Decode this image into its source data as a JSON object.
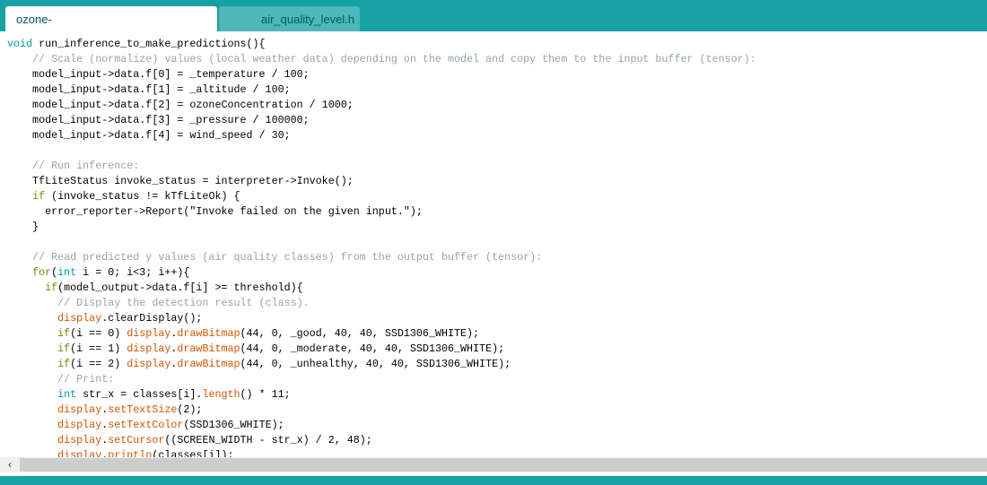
{
  "tabs": [
    {
      "label": "ozone-enabled_weather_station_run_model",
      "active": true
    },
    {
      "label": "air_quality_level.h",
      "active": false
    }
  ],
  "colors": {
    "accent": "#17a1a5",
    "keyword": "#00979c",
    "control": "#728e00",
    "function": "#d35400",
    "comment": "#95a5a6"
  },
  "scrollbar": {
    "left_arrow_icon": "chevron-left-icon",
    "left_arrow": "‹"
  },
  "code_lines": [
    [
      [
        "void",
        "kw"
      ],
      [
        " run_inference_to_make_predictions(){",
        ""
      ]
    ],
    [
      [
        "    // Scale (normalize) values (local weather data) depending on the model and copy them to the input buffer (tensor):",
        "cm"
      ]
    ],
    [
      [
        "    model_input->data.f[0] = _temperature / 100;",
        ""
      ]
    ],
    [
      [
        "    model_input->data.f[1] = _altitude / 100;",
        ""
      ]
    ],
    [
      [
        "    model_input->data.f[2] = ozoneConcentration / 1000;",
        ""
      ]
    ],
    [
      [
        "    model_input->data.f[3] = _pressure / 100000;",
        ""
      ]
    ],
    [
      [
        "    model_input->data.f[4] = wind_speed / 30;",
        ""
      ]
    ],
    [
      [
        "",
        ""
      ]
    ],
    [
      [
        "    // Run inference:",
        "cm"
      ]
    ],
    [
      [
        "    TfLiteStatus invoke_status = interpreter->Invoke();",
        ""
      ]
    ],
    [
      [
        "    ",
        ""
      ],
      [
        "if",
        "ctl"
      ],
      [
        " (invoke_status != kTfLiteOk) {",
        ""
      ]
    ],
    [
      [
        "      error_reporter->Report(\"Invoke failed on the given input.\");",
        ""
      ]
    ],
    [
      [
        "    }",
        ""
      ]
    ],
    [
      [
        "",
        ""
      ]
    ],
    [
      [
        "    // Read predicted y values (air quality classes) from the output buffer (tensor):",
        "cm"
      ]
    ],
    [
      [
        "    ",
        ""
      ],
      [
        "for",
        "ctl"
      ],
      [
        "(",
        ""
      ],
      [
        "int",
        "kw"
      ],
      [
        " i = 0; i<3; i++){",
        ""
      ]
    ],
    [
      [
        "      ",
        ""
      ],
      [
        "if",
        "ctl"
      ],
      [
        "(model_output->data.f[i] >= threshold){",
        ""
      ]
    ],
    [
      [
        "        // Display the detection result (class).",
        "cm"
      ]
    ],
    [
      [
        "        ",
        ""
      ],
      [
        "display",
        "fn"
      ],
      [
        ".clearDisplay();",
        ""
      ]
    ],
    [
      [
        "        ",
        ""
      ],
      [
        "if",
        "ctl"
      ],
      [
        "(i == 0) ",
        ""
      ],
      [
        "display",
        "fn"
      ],
      [
        ".",
        ""
      ],
      [
        "drawBitmap",
        "fn"
      ],
      [
        "(44, 0, _good, 40, 40, SSD1306_WHITE);",
        ""
      ]
    ],
    [
      [
        "        ",
        ""
      ],
      [
        "if",
        "ctl"
      ],
      [
        "(i == 1) ",
        ""
      ],
      [
        "display",
        "fn"
      ],
      [
        ".",
        ""
      ],
      [
        "drawBitmap",
        "fn"
      ],
      [
        "(44, 0, _moderate, 40, 40, SSD1306_WHITE);",
        ""
      ]
    ],
    [
      [
        "        ",
        ""
      ],
      [
        "if",
        "ctl"
      ],
      [
        "(i == 2) ",
        ""
      ],
      [
        "display",
        "fn"
      ],
      [
        ".",
        ""
      ],
      [
        "drawBitmap",
        "fn"
      ],
      [
        "(44, 0, _unhealthy, 40, 40, SSD1306_WHITE);",
        ""
      ]
    ],
    [
      [
        "        // Print:",
        "cm"
      ]
    ],
    [
      [
        "        ",
        ""
      ],
      [
        "int",
        "kw"
      ],
      [
        " str_x = classes[i].",
        ""
      ],
      [
        "length",
        "fn"
      ],
      [
        "() * 11;",
        ""
      ]
    ],
    [
      [
        "        ",
        ""
      ],
      [
        "display",
        "fn"
      ],
      [
        ".",
        ""
      ],
      [
        "setTextSize",
        "fn"
      ],
      [
        "(2);",
        ""
      ]
    ],
    [
      [
        "        ",
        ""
      ],
      [
        "display",
        "fn"
      ],
      [
        ".",
        ""
      ],
      [
        "setTextColor",
        "fn"
      ],
      [
        "(SSD1306_WHITE);",
        ""
      ]
    ],
    [
      [
        "        ",
        ""
      ],
      [
        "display",
        "fn"
      ],
      [
        ".",
        ""
      ],
      [
        "setCursor",
        "fn"
      ],
      [
        "((SCREEN_WIDTH - str_x) / 2, 48);",
        ""
      ]
    ],
    [
      [
        "        ",
        ""
      ],
      [
        "display",
        "fn"
      ],
      [
        ".",
        ""
      ],
      [
        "println",
        "fn"
      ],
      [
        "(classes[i]);",
        ""
      ]
    ]
  ]
}
